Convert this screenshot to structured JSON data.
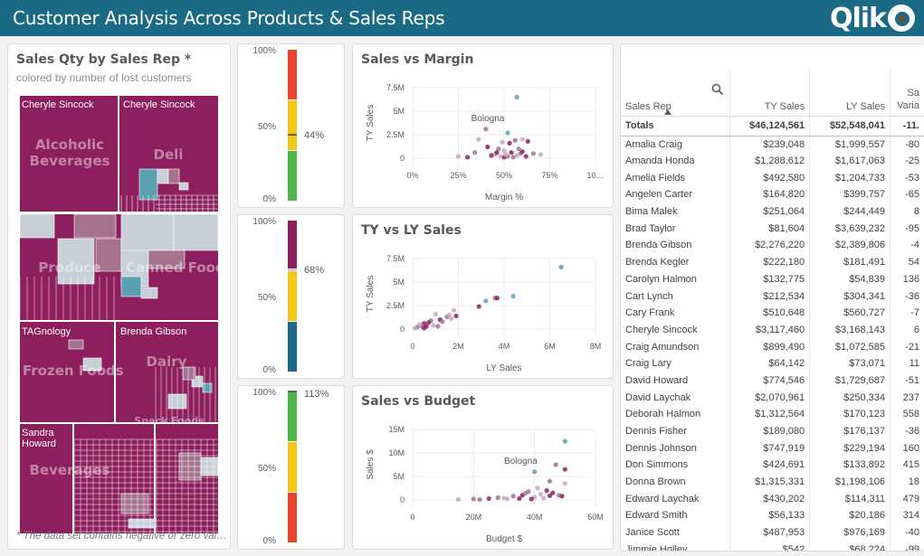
{
  "app": {
    "title": "Customer Analysis Across Products & Sales Reps",
    "logo": "Qlik"
  },
  "treemap_panel": {
    "title": "Sales Qty by Sales Rep *",
    "subtitle": "colored by number of lost customers",
    "footnote": "* The data set contains negative or zero val…",
    "rep_labels": [
      "Cheryle Sincock",
      "Cheryle Sincock",
      "TAGnology",
      "Brenda Gibson",
      "Sandra\nHoward"
    ],
    "category_labels": [
      "Alcoholic\nBeverages",
      "Deli",
      "Produce",
      "Canned Foods",
      "Frozen Foods",
      "Dairy",
      "Snack Foods",
      "Beverages"
    ],
    "colors": {
      "primary": "#8e1f5e",
      "light": "#c8cfd6",
      "mid": "#a5738e",
      "teal": "#5aa0b0"
    }
  },
  "gauges": [
    {
      "ticks": [
        "100%",
        "50%",
        "0%"
      ],
      "value_label": "44%",
      "value": 0.44,
      "bands": [
        "#e8462b",
        "#f2c618",
        "#4cb848"
      ]
    },
    {
      "ticks": [
        "100%",
        "50%",
        "0%"
      ],
      "value_label": "68%",
      "value": 0.68,
      "bands": [
        "#8e1f5e",
        "#f2c618",
        "#1a6a86"
      ]
    },
    {
      "ticks": [
        "100%",
        "50%",
        "0%"
      ],
      "value_label": "113%",
      "value": 1.13,
      "bands": [
        "#4cb848",
        "#f2c618",
        "#e8462b"
      ]
    }
  ],
  "chart_data": [
    {
      "type": "scatter",
      "title": "Sales vs Margin",
      "xlabel": "Margin %",
      "ylabel": "TY Sales",
      "x_ticks": [
        "0%",
        "25%",
        "50%",
        "75%",
        "10…"
      ],
      "y_ticks": [
        "7.5M",
        "5M",
        "2.5M",
        "0"
      ],
      "xlim": [
        0,
        1.0
      ],
      "ylim": [
        0,
        7.5
      ],
      "annotation": "Bologna",
      "points": [
        [
          0.57,
          6.5
        ],
        [
          0.4,
          3.1
        ],
        [
          0.36,
          2.0
        ],
        [
          0.41,
          1.2
        ],
        [
          0.52,
          2.7
        ],
        [
          0.6,
          2.0
        ],
        [
          0.63,
          1.8
        ],
        [
          0.56,
          1.9
        ],
        [
          0.49,
          1.7
        ],
        [
          0.53,
          1.6
        ],
        [
          0.47,
          1.0
        ],
        [
          0.5,
          0.8
        ],
        [
          0.54,
          0.6
        ],
        [
          0.59,
          0.5
        ],
        [
          0.45,
          0.4
        ],
        [
          0.43,
          0.3
        ],
        [
          0.52,
          0.2
        ],
        [
          0.57,
          0.3
        ],
        [
          0.62,
          0.2
        ],
        [
          0.34,
          0.6
        ],
        [
          0.25,
          0.2
        ],
        [
          0.3,
          0.1
        ],
        [
          0.66,
          0.5
        ],
        [
          0.7,
          0.4
        ],
        [
          0.5,
          0.1
        ],
        [
          0.55,
          0.1
        ],
        [
          0.48,
          0.2
        ],
        [
          0.46,
          0.6
        ],
        [
          0.58,
          1.0
        ],
        [
          0.51,
          0.4
        ],
        [
          0.6,
          0.7
        ]
      ]
    },
    {
      "type": "scatter",
      "title": "TY vs LY Sales",
      "xlabel": "LY Sales",
      "ylabel": "TY Sales",
      "x_ticks": [
        "0",
        "2M",
        "4M",
        "6M",
        "8M"
      ],
      "y_ticks": [
        "7.5M",
        "5M",
        "2.5M",
        "0"
      ],
      "xlim": [
        0,
        8
      ],
      "ylim": [
        0,
        7.5
      ],
      "points": [
        [
          6.5,
          6.6
        ],
        [
          3.6,
          3.3
        ],
        [
          3.2,
          3.0
        ],
        [
          3.7,
          3.3
        ],
        [
          4.4,
          3.5
        ],
        [
          1.8,
          2.0
        ],
        [
          1.9,
          1.4
        ],
        [
          1.5,
          1.3
        ],
        [
          1.6,
          1.5
        ],
        [
          1.2,
          1.0
        ],
        [
          0.8,
          0.9
        ],
        [
          1.0,
          1.6
        ],
        [
          0.5,
          0.6
        ],
        [
          0.4,
          0.3
        ],
        [
          0.3,
          0.5
        ],
        [
          0.6,
          0.3
        ],
        [
          0.2,
          0.2
        ],
        [
          0.9,
          0.4
        ],
        [
          0.7,
          0.7
        ],
        [
          1.3,
          0.8
        ],
        [
          0.1,
          0.1
        ],
        [
          0.5,
          0.1
        ],
        [
          1.1,
          0.3
        ],
        [
          1.7,
          1.1
        ],
        [
          2.9,
          2.4
        ]
      ]
    },
    {
      "type": "scatter",
      "title": "Sales vs Budget",
      "xlabel": "Budget $",
      "ylabel": "Sales $",
      "x_ticks": [
        "0",
        "20M",
        "40M",
        "60M"
      ],
      "y_ticks": [
        "15M",
        "10M",
        "5M",
        "0"
      ],
      "xlim": [
        0,
        60
      ],
      "ylim": [
        0,
        15
      ],
      "annotation": "Bologna",
      "points": [
        [
          50,
          12.5
        ],
        [
          47,
          7.5
        ],
        [
          40,
          6.0
        ],
        [
          50,
          6.5
        ],
        [
          45,
          4.0
        ],
        [
          50,
          3.5
        ],
        [
          44,
          2.0
        ],
        [
          38,
          1.8
        ],
        [
          42,
          1.2
        ],
        [
          36,
          1.0
        ],
        [
          33,
          0.8
        ],
        [
          40,
          0.6
        ],
        [
          46,
          1.5
        ],
        [
          48,
          1.0
        ],
        [
          30,
          0.4
        ],
        [
          25,
          0.3
        ],
        [
          20,
          0.2
        ],
        [
          15,
          0.1
        ],
        [
          35,
          0.3
        ],
        [
          28,
          0.5
        ],
        [
          43,
          0.4
        ],
        [
          49,
          0.8
        ],
        [
          37,
          1.4
        ],
        [
          41,
          2.5
        ],
        [
          39,
          0.2
        ],
        [
          22,
          0.1
        ],
        [
          31,
          0.2
        ],
        [
          45,
          0.9
        ]
      ]
    }
  ],
  "table": {
    "columns": [
      "Sales Rep",
      "TY Sales",
      "LY Sales",
      "Sa\nVaria"
    ],
    "totals": [
      "Totals",
      "$46,124,561",
      "$52,548,041",
      "-11."
    ],
    "rows": [
      [
        "Amalia Craig",
        "$239,048",
        "$1,999,557",
        "-80"
      ],
      [
        "Amanda Honda",
        "$1,288,612",
        "$1,617,063",
        "-25"
      ],
      [
        "Amelia Fields",
        "$492,580",
        "$1,204,733",
        "-53"
      ],
      [
        "Angelen Carter",
        "$164,820",
        "$399,757",
        "-65"
      ],
      [
        "Bima Malek",
        "$251,064",
        "$244,449",
        "8"
      ],
      [
        "Brad Taylor",
        "$81,604",
        "$3,639,232",
        "-95"
      ],
      [
        "Brenda Gibson",
        "$2,276,220",
        "$2,389,806",
        "-4"
      ],
      [
        "Brenda Kegler",
        "$222,180",
        "$181,491",
        "54"
      ],
      [
        "Carolyn Halmon",
        "$132,775",
        "$54,839",
        "136"
      ],
      [
        "Cart Lynch",
        "$212,534",
        "$304,341",
        "-36"
      ],
      [
        "Cary Frank",
        "$510,648",
        "$560,727",
        "-7"
      ],
      [
        "Cheryle Sincock",
        "$3,117,460",
        "$3,168,143",
        "6"
      ],
      [
        "Craig Amundson",
        "$899,490",
        "$1,072,585",
        "-21"
      ],
      [
        "Craig Lary",
        "$64,142",
        "$73,071",
        "11"
      ],
      [
        "David Howard",
        "$774,546",
        "$1,729,687",
        "-51"
      ],
      [
        "David Laychak",
        "$2,070,961",
        "$250,334",
        "237"
      ],
      [
        "Deborah Halmon",
        "$1,312,564",
        "$170,123",
        "558"
      ],
      [
        "Dennis Fisher",
        "$189,080",
        "$176,137",
        "-36"
      ],
      [
        "Dennis Johnson",
        "$747,919",
        "$229,194",
        "160"
      ],
      [
        "Don Simmons",
        "$424,691",
        "$133,892",
        "415"
      ],
      [
        "Donna Brown",
        "$1,315,331",
        "$1,198,106",
        "18"
      ],
      [
        "Edward Laychak",
        "$430,202",
        "$114,311",
        "479"
      ],
      [
        "Edward Smith",
        "$56,133",
        "$20,186",
        "314"
      ],
      [
        "Janice Scott",
        "$487,953",
        "$976,169",
        "-40"
      ],
      [
        "Jimmie Holley",
        "$542",
        "$68,224",
        "-99"
      ]
    ]
  }
}
